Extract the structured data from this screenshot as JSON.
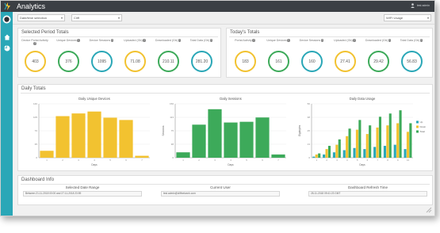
{
  "app": {
    "title": "Analytics",
    "user": "test admin",
    "colors": {
      "header": "#3b3f44",
      "sidebar": "#2aa7b7",
      "yellow": "#f2c230",
      "green": "#3daa5a",
      "teal": "#2aa7b7"
    }
  },
  "sidebar": {
    "items": [
      {
        "icon": "app-logo-icon"
      },
      {
        "icon": "home-icon"
      },
      {
        "icon": "pie-chart-icon"
      }
    ]
  },
  "toolbar": {
    "period_select": "Date/time selection",
    "mode_select": "Cliff",
    "usage_select": "WIFI Usage"
  },
  "selected_totals": {
    "title": "Selected Period Totals",
    "kpis": [
      {
        "label": "Device Portal Activity",
        "value": "403",
        "ring": "yellow"
      },
      {
        "label": "Unique Devices",
        "value": "376",
        "ring": "green"
      },
      {
        "label": "Device Sessions",
        "value": "1095",
        "ring": "teal"
      },
      {
        "label": "Uploaded (Gb)",
        "value": "71.08",
        "ring": "yellow"
      },
      {
        "label": "Downloaded (Gb)",
        "value": "210.11",
        "ring": "green"
      },
      {
        "label": "Total Data (Gb)",
        "value": "281.20",
        "ring": "teal"
      }
    ]
  },
  "today_totals": {
    "title": "Today's Totals",
    "kpis": [
      {
        "label": "Portal Activity",
        "value": "183",
        "ring": "yellow"
      },
      {
        "label": "Unique Devices",
        "value": "161",
        "ring": "green"
      },
      {
        "label": "Device Sessions",
        "value": "160",
        "ring": "teal"
      },
      {
        "label": "Uploaded (Gb)",
        "value": "27.41",
        "ring": "yellow"
      },
      {
        "label": "Downloaded (Gb)",
        "value": "29.42",
        "ring": "green"
      },
      {
        "label": "Total Data (Gb)",
        "value": "56.83",
        "ring": "teal"
      }
    ]
  },
  "daily_totals": {
    "title": "Daily Totals"
  },
  "chart_data": [
    {
      "type": "bar",
      "title": "Daily Unique Devices",
      "xlabel": "Days",
      "ylabel": "",
      "categories": [
        "1",
        "2",
        "3",
        "4",
        "5",
        "6",
        "7"
      ],
      "values": [
        18,
        108,
        115,
        120,
        104,
        98,
        5
      ],
      "ylim": [
        0,
        140
      ],
      "color": "#f2c230",
      "legend": "none"
    },
    {
      "type": "bar",
      "title": "Daily Sessions",
      "xlabel": "Days",
      "ylabel": "Sessions",
      "categories": [
        "1",
        "2",
        "3",
        "4",
        "5",
        "6",
        "7"
      ],
      "values": [
        15,
        92,
        135,
        98,
        100,
        112,
        9
      ],
      "ylim": [
        0,
        150
      ],
      "color": "#3daa5a",
      "legend": "none"
    },
    {
      "type": "bar",
      "title": "Daily Data Usage",
      "xlabel": "Days",
      "ylabel": "Gigabytes",
      "categories": [
        "1",
        "2",
        "3",
        "4",
        "5",
        "6",
        "7",
        "8",
        "9",
        "10"
      ],
      "series": [
        {
          "name": "Up",
          "values": [
            1,
            3,
            5,
            7,
            9,
            8,
            10,
            11,
            12,
            8
          ],
          "color": "#2aa7b7"
        },
        {
          "name": "Down",
          "values": [
            3,
            8,
            12,
            20,
            26,
            22,
            28,
            30,
            32,
            24
          ],
          "color": "#f2c230"
        },
        {
          "name": "Total",
          "values": [
            4,
            11,
            17,
            27,
            35,
            30,
            38,
            41,
            44,
            32
          ],
          "color": "#3daa5a"
        }
      ],
      "ylim": [
        0,
        50
      ],
      "legend": "right"
    }
  ],
  "dashboard_info": {
    "title": "Dashboard Info",
    "selected_range": {
      "label": "Selected Date Range",
      "value": "Between 21-11-2018 00:00 and 27-11-2018 23:59"
    },
    "current_user": {
      "label": "Current User",
      "value": "test.admin@cliffnetwork.com"
    },
    "refresh_time": {
      "label": "Dashboard Refresh Time",
      "value": "28-11-2018 09:41:23 GMT"
    }
  }
}
